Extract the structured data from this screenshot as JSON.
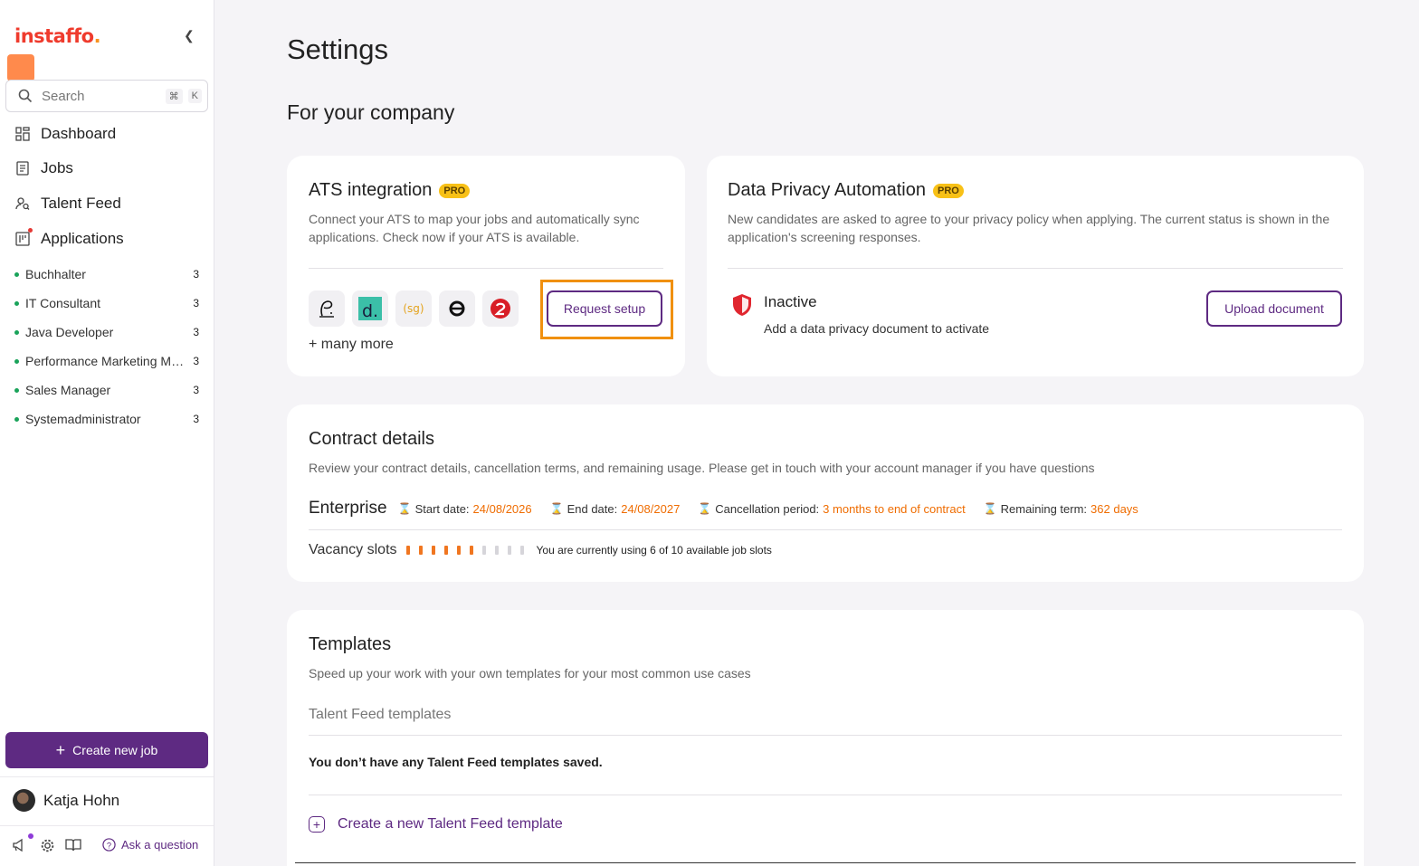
{
  "sidebar": {
    "logo": "instaffo",
    "logo_dot": ".",
    "search": {
      "placeholder": "Search",
      "shortcut_cmd": "⌘",
      "shortcut_key": "K"
    },
    "nav": [
      {
        "label": "Dashboard",
        "icon": "dashboard-icon"
      },
      {
        "label": "Jobs",
        "icon": "jobs-icon"
      },
      {
        "label": "Talent Feed",
        "icon": "talent-feed-icon"
      },
      {
        "label": "Applications",
        "icon": "applications-icon"
      }
    ],
    "jobs": [
      {
        "name": "Buchhalter",
        "count": "3"
      },
      {
        "name": "IT Consultant",
        "count": "3"
      },
      {
        "name": "Java Developer",
        "count": "3"
      },
      {
        "name": "Performance Marketing Manager",
        "count": "3"
      },
      {
        "name": "Sales Manager",
        "count": "3"
      },
      {
        "name": "Systemadministrator",
        "count": "3"
      }
    ],
    "create_job": "Create new job",
    "user_name": "Katja Hohn",
    "ask_question": "Ask a question"
  },
  "page": {
    "title": "Settings",
    "section": "For your company"
  },
  "ats": {
    "title": "ATS integration",
    "badge": "PRO",
    "description": "Connect your ATS to map your jobs and automatically sync applications. Check now if your ATS is available.",
    "more": "+ many more",
    "button": "Request setup"
  },
  "privacy": {
    "title": "Data Privacy Automation",
    "badge": "PRO",
    "description": "New candidates are asked to agree to your privacy policy when applying. The current status is shown in the application's screening responses.",
    "status": "Inactive",
    "status_sub": "Add a data privacy document to activate",
    "button": "Upload document"
  },
  "contract": {
    "title": "Contract details",
    "description": "Review your contract details, cancellation terms, and remaining usage. Please get in touch with your account manager if you have questions",
    "plan": "Enterprise",
    "start_label": "Start date:",
    "start_value": "24/08/2026",
    "end_label": "End date:",
    "end_value": "24/08/2027",
    "cancel_label": "Cancellation period:",
    "cancel_value": "3 months to end of contract",
    "remaining_label": "Remaining term:",
    "remaining_value": "362 days",
    "vacancy_label": "Vacancy slots",
    "slots_used": 6,
    "slots_total": 10,
    "vacancy_text": "You are currently using 6 of 10 available job slots"
  },
  "templates": {
    "title": "Templates",
    "description": "Speed up your work with your own templates for your most common use cases",
    "subheading": "Talent Feed templates",
    "empty": "You don’t have any Talent Feed templates saved.",
    "create": "Create a new Talent Feed template"
  },
  "colors": {
    "accent": "#5e2a82",
    "orange": "#f07620",
    "highlight": "#f0900f",
    "pro": "#f8c117"
  }
}
